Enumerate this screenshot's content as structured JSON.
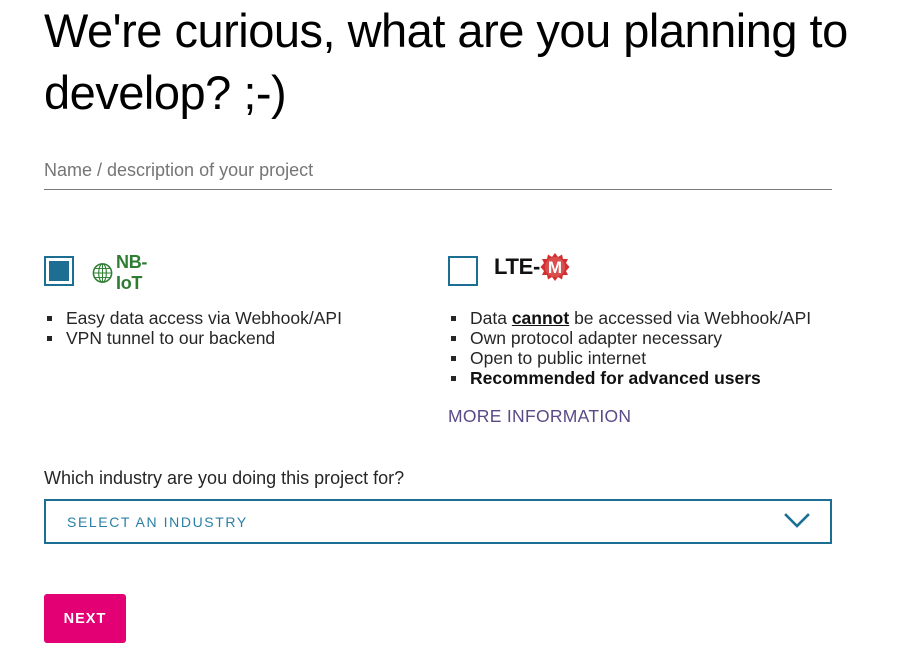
{
  "heading": "We're curious, what are you planning to develop? ;-)",
  "project": {
    "placeholder": "Name / description of your project",
    "value": ""
  },
  "options": {
    "nbiot": {
      "logo_text": "NB-IoT",
      "checked": true,
      "features": [
        "Easy data access via Webhook/API",
        "VPN tunnel to our backend"
      ]
    },
    "ltem": {
      "logo_text": "LTE-",
      "logo_badge": "M",
      "checked": false,
      "feature_1_prefix": "Data ",
      "feature_1_emphasis": "cannot",
      "feature_1_suffix": " be accessed via Webhook/API",
      "features": [
        "Own protocol adapter necessary",
        "Open to public internet"
      ],
      "feature_strong": "Recommended for advanced users",
      "more_info": "MORE INFORMATION"
    }
  },
  "industry": {
    "label": "Which industry are you doing this project for?",
    "selected": "SELECT AN INDUSTRY"
  },
  "next_label": "NEXT",
  "colors": {
    "accent_blue": "#1c6f93",
    "brand_magenta": "#e20074",
    "link_purple": "#5a4a86",
    "nbiot_green": "#2e7d32",
    "ltem_red": "#d32f2f"
  },
  "icons": {
    "dropdown": "chevron-down-icon",
    "nbiot": "nbiot-globe-icon",
    "ltem": "ltem-badge-icon"
  }
}
